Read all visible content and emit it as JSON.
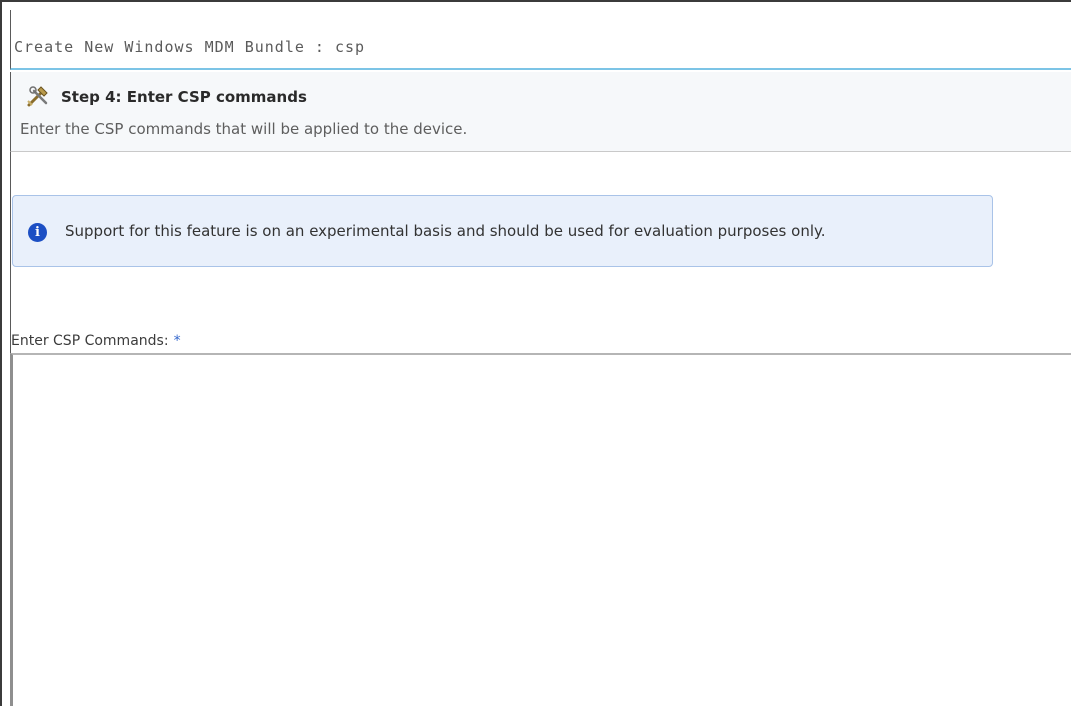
{
  "header": {
    "title": "Create New Windows MDM Bundle : csp"
  },
  "step": {
    "icon": "tools-icon",
    "title": "Step 4: Enter CSP commands",
    "description": "Enter the CSP commands that will be applied to the device."
  },
  "notice": {
    "icon": "info-icon",
    "icon_glyph": "i",
    "text": "Support for this feature is on an experimental basis and should be used for evaluation purposes only.",
    "accent": "#1c4fc4",
    "background": "#e9f0fb"
  },
  "form": {
    "csp_label": "Enter CSP Commands:",
    "required_marker": "*",
    "csp_value": ""
  },
  "colors": {
    "title_underline": "#7cc4e6",
    "required": "#3366cc"
  }
}
